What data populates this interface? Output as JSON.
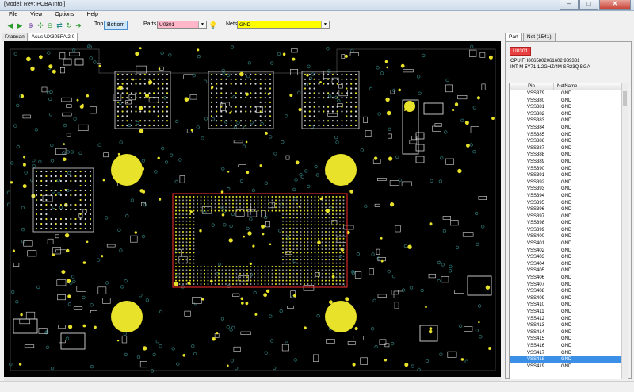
{
  "window": {
    "title": "[Model: Rev: PCBA Info:]"
  },
  "menu": [
    "File",
    "View",
    "Options",
    "Help"
  ],
  "toolbar": {
    "side_top": "Top",
    "side_bottom": "Bottom",
    "parts_label": "Parts:",
    "parts_value": "U0301",
    "nets_label": "Nets:",
    "nets_value": "GND"
  },
  "tabs": [
    "Главная",
    "Asus UX305FA 2.0"
  ],
  "panel": {
    "tabs": [
      "Part",
      "Net (1541)"
    ],
    "part_badge": "U0301",
    "desc1": "CPU FH8065802061602 939331",
    "desc2": "INT M-5Y71 1.2GHZ/4M SR23Q BGA",
    "columns": [
      "Pin",
      "NetName"
    ],
    "rows": [
      [
        "VSS379",
        "GND"
      ],
      [
        "VSS380",
        "GND"
      ],
      [
        "VSS381",
        "GND"
      ],
      [
        "VSS382",
        "GND"
      ],
      [
        "VSS383",
        "GND"
      ],
      [
        "VSS384",
        "GND"
      ],
      [
        "VSS385",
        "GND"
      ],
      [
        "VSS386",
        "GND"
      ],
      [
        "VSS387",
        "GND"
      ],
      [
        "VSS388",
        "GND"
      ],
      [
        "VSS389",
        "GND"
      ],
      [
        "VSS390",
        "GND"
      ],
      [
        "VSS391",
        "GND"
      ],
      [
        "VSS392",
        "GND"
      ],
      [
        "VSS393",
        "GND"
      ],
      [
        "VSS394",
        "GND"
      ],
      [
        "VSS395",
        "GND"
      ],
      [
        "VSS396",
        "GND"
      ],
      [
        "VSS397",
        "GND"
      ],
      [
        "VSS398",
        "GND"
      ],
      [
        "VSS399",
        "GND"
      ],
      [
        "VSS400",
        "GND"
      ],
      [
        "VSS401",
        "GND"
      ],
      [
        "VSS402",
        "GND"
      ],
      [
        "VSS403",
        "GND"
      ],
      [
        "VSS404",
        "GND"
      ],
      [
        "VSS405",
        "GND"
      ],
      [
        "VSS406",
        "GND"
      ],
      [
        "VSS407",
        "GND"
      ],
      [
        "VSS408",
        "GND"
      ],
      [
        "VSS409",
        "GND"
      ],
      [
        "VSS410",
        "GND"
      ],
      [
        "VSS411",
        "GND"
      ],
      [
        "VSS412",
        "GND"
      ],
      [
        "VSS413",
        "GND"
      ],
      [
        "VSS414",
        "GND"
      ],
      [
        "VSS415",
        "GND"
      ],
      [
        "VSS416",
        "GND"
      ],
      [
        "VSS417",
        "GND"
      ],
      [
        "VSS418",
        "GND"
      ],
      [
        "VSS419",
        "GND"
      ]
    ],
    "selected_row": 39
  },
  "colors": {
    "board_bg": "#000000",
    "pad_yellow": "#e8e22a",
    "outline": "#d8d8d8",
    "via": "#2a6e6e",
    "part_outline": "#ff3030",
    "selection": "#3b8fe6"
  }
}
